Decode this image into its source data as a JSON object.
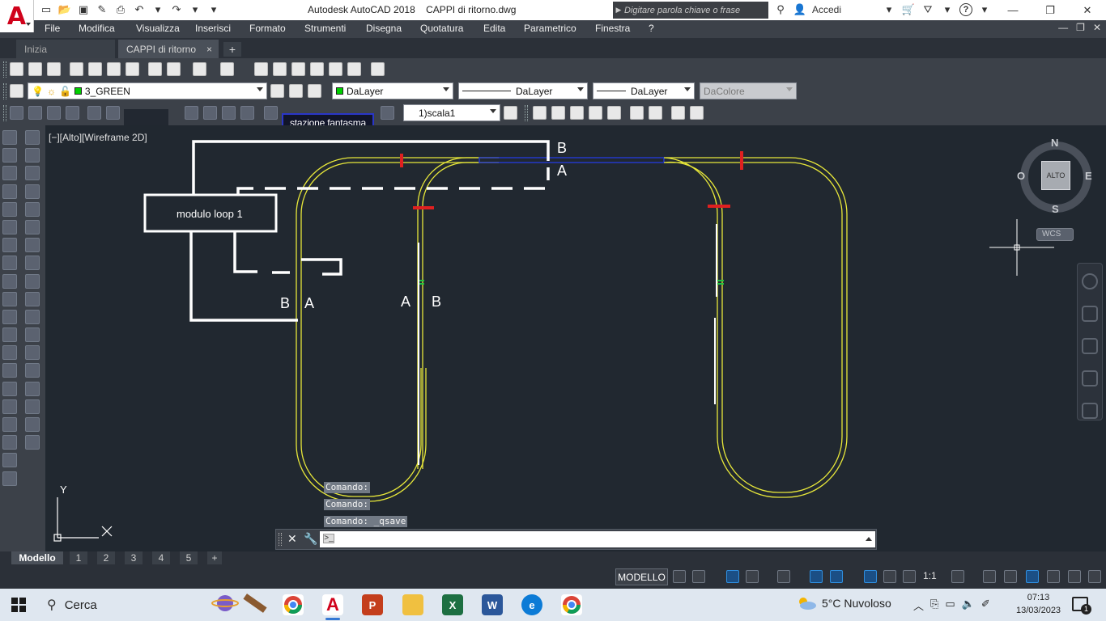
{
  "window": {
    "title": "Autodesk AutoCAD 2018    CAPPI di ritorno.dwg",
    "search_placeholder": "Digitare parola chiave o frase",
    "signin": "Accedi",
    "help": "?"
  },
  "menu": {
    "items": [
      "File",
      "Modifica",
      "Visualizza",
      "Inserisci",
      "Formato",
      "Strumenti",
      "Disegna",
      "Quotatura",
      "Edita",
      "Parametrico",
      "Finestra",
      "?"
    ]
  },
  "tabs": {
    "start": "Inizia",
    "document": "CAPPI di ritorno",
    "close_glyph": "×",
    "new_glyph": "+"
  },
  "properties": {
    "layer": "3_GREEN",
    "color": "DaLayer",
    "linetype": "DaLayer",
    "lineweight": "DaLayer",
    "plotstyle": "DaColore",
    "scale": "1)scala1",
    "layer_color": "#00d000"
  },
  "tooltip": {
    "text": "stazione fantasma"
  },
  "viewport": {
    "label": "[−][Alto][Wireframe 2D]",
    "ucs_x": "X",
    "ucs_y": "Y"
  },
  "drawing": {
    "module_label": "modulo loop 1",
    "labels": {
      "top_b": "B",
      "top_a": "A",
      "left_b": "B",
      "left_a": "A",
      "mid_a": "A",
      "mid_b": "B"
    },
    "colors": {
      "track": "#e8e83a",
      "wire": "#ffffff",
      "marker": "#e02020",
      "blue_section": "#2438c8",
      "joint": "#20c040"
    }
  },
  "viewcube": {
    "north": "N",
    "south": "S",
    "east": "E",
    "west": "O",
    "face": "ALTO",
    "wcs": "WCS"
  },
  "command": {
    "history": [
      "Comando:",
      "Comando:",
      "Comando: _qsave"
    ],
    "prompt": ">_",
    "input_value": "",
    "close_glyph": "✕",
    "custom_glyph": "🔧"
  },
  "layouts": {
    "tabs": [
      "Modello",
      "1",
      "2",
      "3",
      "4",
      "5"
    ],
    "add_glyph": "+"
  },
  "status": {
    "model": "MODELLO",
    "scale": "1:1"
  },
  "taskbar": {
    "search": "Cerca",
    "weather": "5°C  Nuvoloso",
    "time": "07:13",
    "date": "13/03/2023",
    "notifications": "1"
  }
}
